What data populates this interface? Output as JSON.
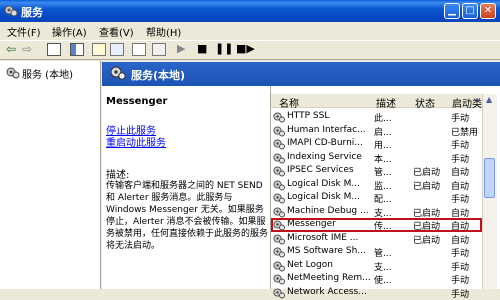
{
  "window": {
    "title": "服务"
  },
  "menu": [
    {
      "label": "文件(F)"
    },
    {
      "label": "操作(A)"
    },
    {
      "label": "查看(V)"
    },
    {
      "label": "帮助(H)"
    }
  ],
  "tree": {
    "root_label": "服务 (本地)"
  },
  "panel": {
    "title": "服务(本地)"
  },
  "detail": {
    "service_name": "Messenger",
    "stop_link": "停止此服务",
    "restart_link": "重启动此服务",
    "desc_label": "描述:",
    "description": "传输客户端和服务器之间的 NET SEND 和 Alerter 服务消息。此服务与 Windows Messenger 无关。如果服务停止，Alerter 消息不会被传输。如果服务被禁用，任何直接依赖于此服务的服务将无法启动。"
  },
  "columns": {
    "name": "名称",
    "description": "描述",
    "status": "状态",
    "startup": "启动类"
  },
  "services": [
    {
      "name": "HTTP SSL",
      "desc": "此...",
      "status": "",
      "startup": "手动"
    },
    {
      "name": "Human Interfac...",
      "desc": "启...",
      "status": "",
      "startup": "已禁用"
    },
    {
      "name": "IMAPI CD-Burni...",
      "desc": "用...",
      "status": "",
      "startup": "手动"
    },
    {
      "name": "Indexing Service",
      "desc": "本...",
      "status": "",
      "startup": "手动"
    },
    {
      "name": "IPSEC Services",
      "desc": "管...",
      "status": "已启动",
      "startup": "自动"
    },
    {
      "name": "Logical Disk M...",
      "desc": "监...",
      "status": "已启动",
      "startup": "自动"
    },
    {
      "name": "Logical Disk M...",
      "desc": "配...",
      "status": "",
      "startup": "手动"
    },
    {
      "name": "Machine Debug ...",
      "desc": "支...",
      "status": "已启动",
      "startup": "自动"
    },
    {
      "name": "Messenger",
      "desc": "传...",
      "status": "已启动",
      "startup": "自动"
    },
    {
      "name": "Microsoft IME ...",
      "desc": "",
      "status": "已启动",
      "startup": "自动"
    },
    {
      "name": "MS Software Sh...",
      "desc": "管...",
      "status": "",
      "startup": "手动"
    },
    {
      "name": "Net Logon",
      "desc": "支...",
      "status": "",
      "startup": "手动"
    },
    {
      "name": "NetMeeting Rem...",
      "desc": "使...",
      "status": "",
      "startup": "手动"
    },
    {
      "name": "Network Access...",
      "desc": "",
      "status": "",
      "startup": "手动"
    }
  ],
  "selected_index": 8,
  "colors": {
    "highlight": "#C0101C",
    "title_bar": "#0A57D0",
    "link": "#0000FF"
  }
}
